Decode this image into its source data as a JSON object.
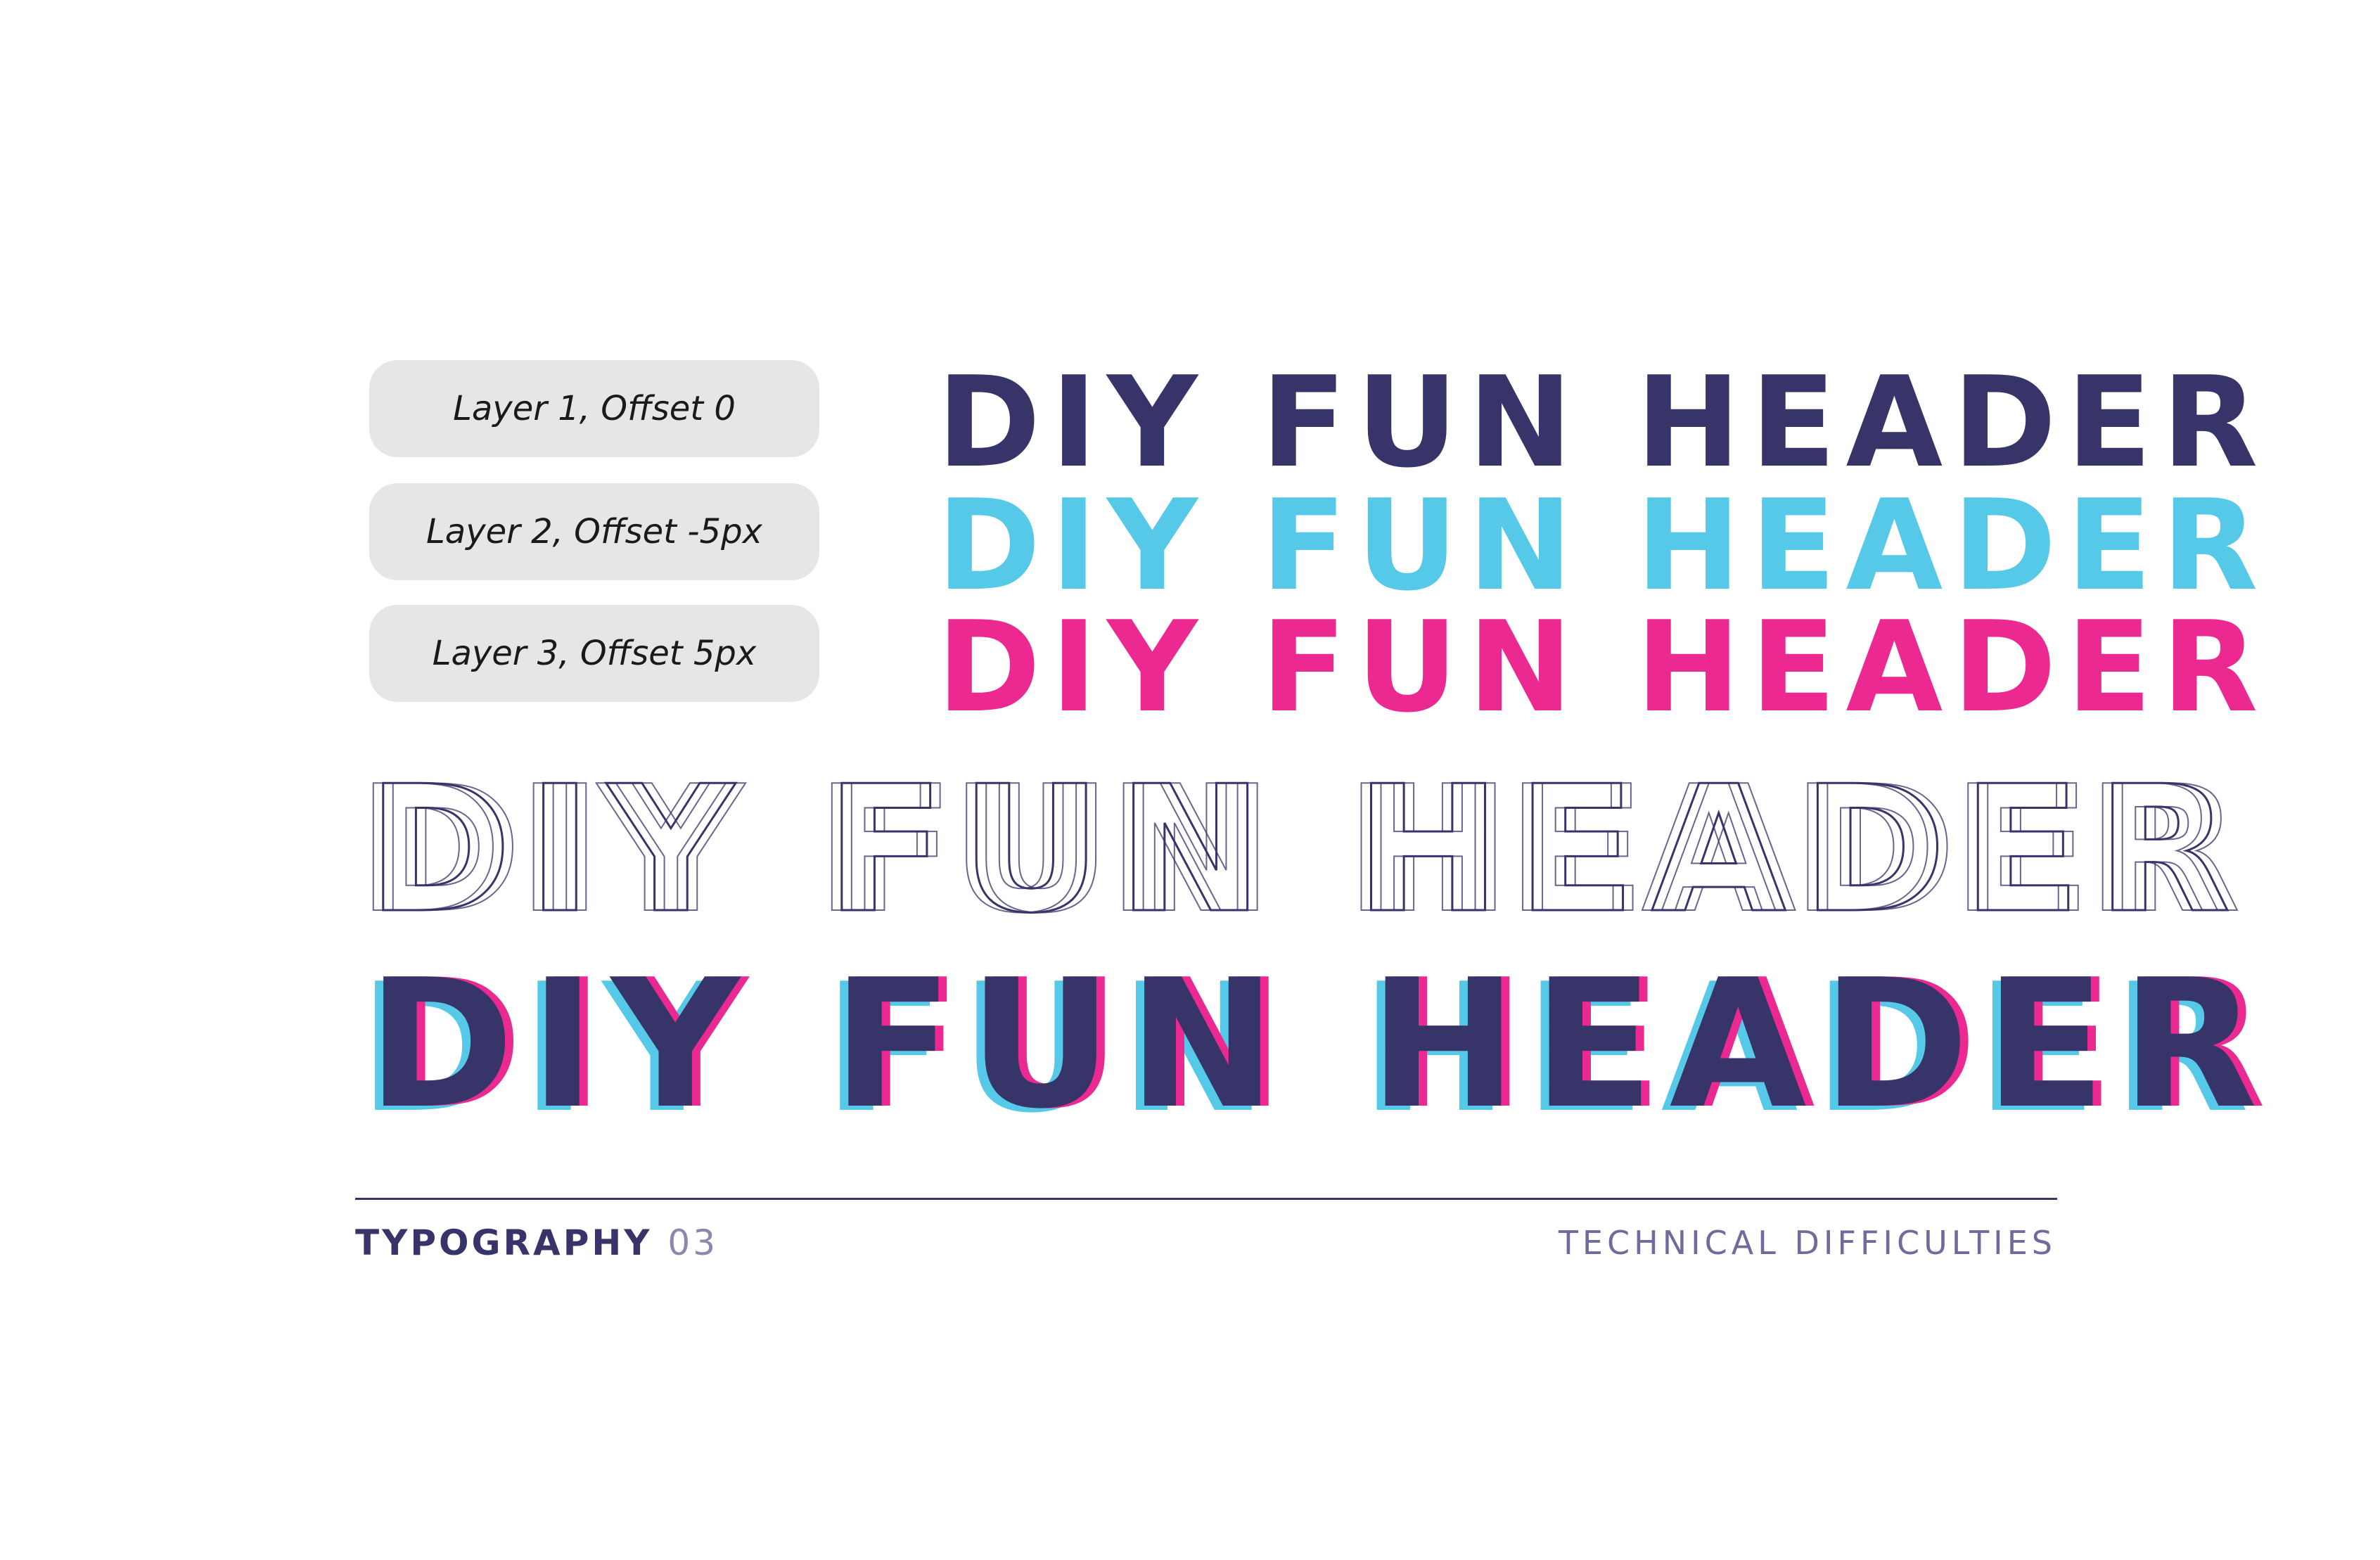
{
  "layers": [
    {
      "label": "Layer 1, Offset 0"
    },
    {
      "label": "Layer 2, Offset -5px"
    },
    {
      "label": "Layer 3, Offset 5px"
    }
  ],
  "header_text": "DIY FUN HEADER",
  "colors": {
    "navy": "#363469",
    "cyan": "#56c9e8",
    "pink": "#ec2891",
    "pill_bg": "#e6e6e6"
  },
  "footer": {
    "title": "TYPOGRAPHY",
    "number": "03",
    "subtitle": "TECHNICAL DIFFICULTIES"
  }
}
